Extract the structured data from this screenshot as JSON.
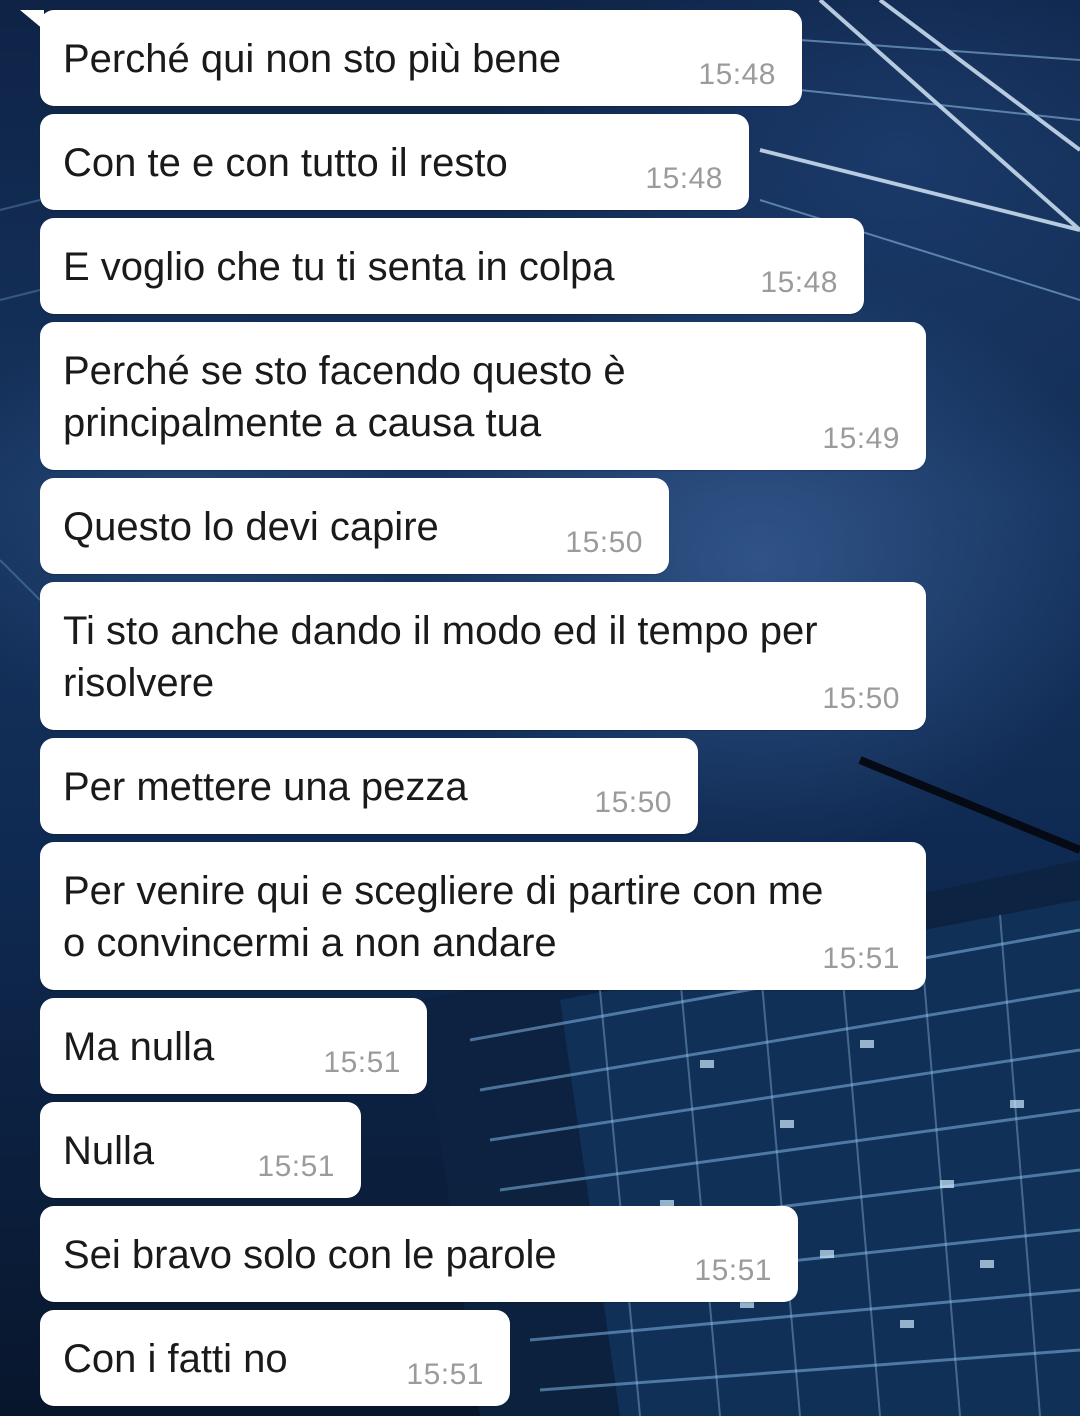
{
  "chat": {
    "messages": [
      {
        "text": "Perché qui non sto più bene",
        "time": "15:48"
      },
      {
        "text": "Con te e con tutto il resto",
        "time": "15:48"
      },
      {
        "text": "E voglio che tu ti senta in colpa",
        "time": "15:48"
      },
      {
        "text": "Perché se sto facendo questo è\nprincipalmente a causa tua",
        "time": "15:49"
      },
      {
        "text": "Questo lo devi capire",
        "time": "15:50"
      },
      {
        "text": "Ti sto anche dando il modo ed il tempo per\nrisolvere",
        "time": "15:50"
      },
      {
        "text": "Per mettere una pezza",
        "time": "15:50"
      },
      {
        "text": "Per venire qui e scegliere di partire con me\no convincermi a non andare",
        "time": "15:51"
      },
      {
        "text": "Ma nulla",
        "time": "15:51"
      },
      {
        "text": "Nulla",
        "time": "15:51"
      },
      {
        "text": "Sei bravo solo con le parole",
        "time": "15:51"
      },
      {
        "text": "Con i fatti no",
        "time": "15:51"
      }
    ]
  },
  "colors": {
    "bubble": "#ffffff",
    "text": "#1a1a1a",
    "timestamp": "#9b9b9b",
    "wallpaper": "#0f2a52"
  }
}
